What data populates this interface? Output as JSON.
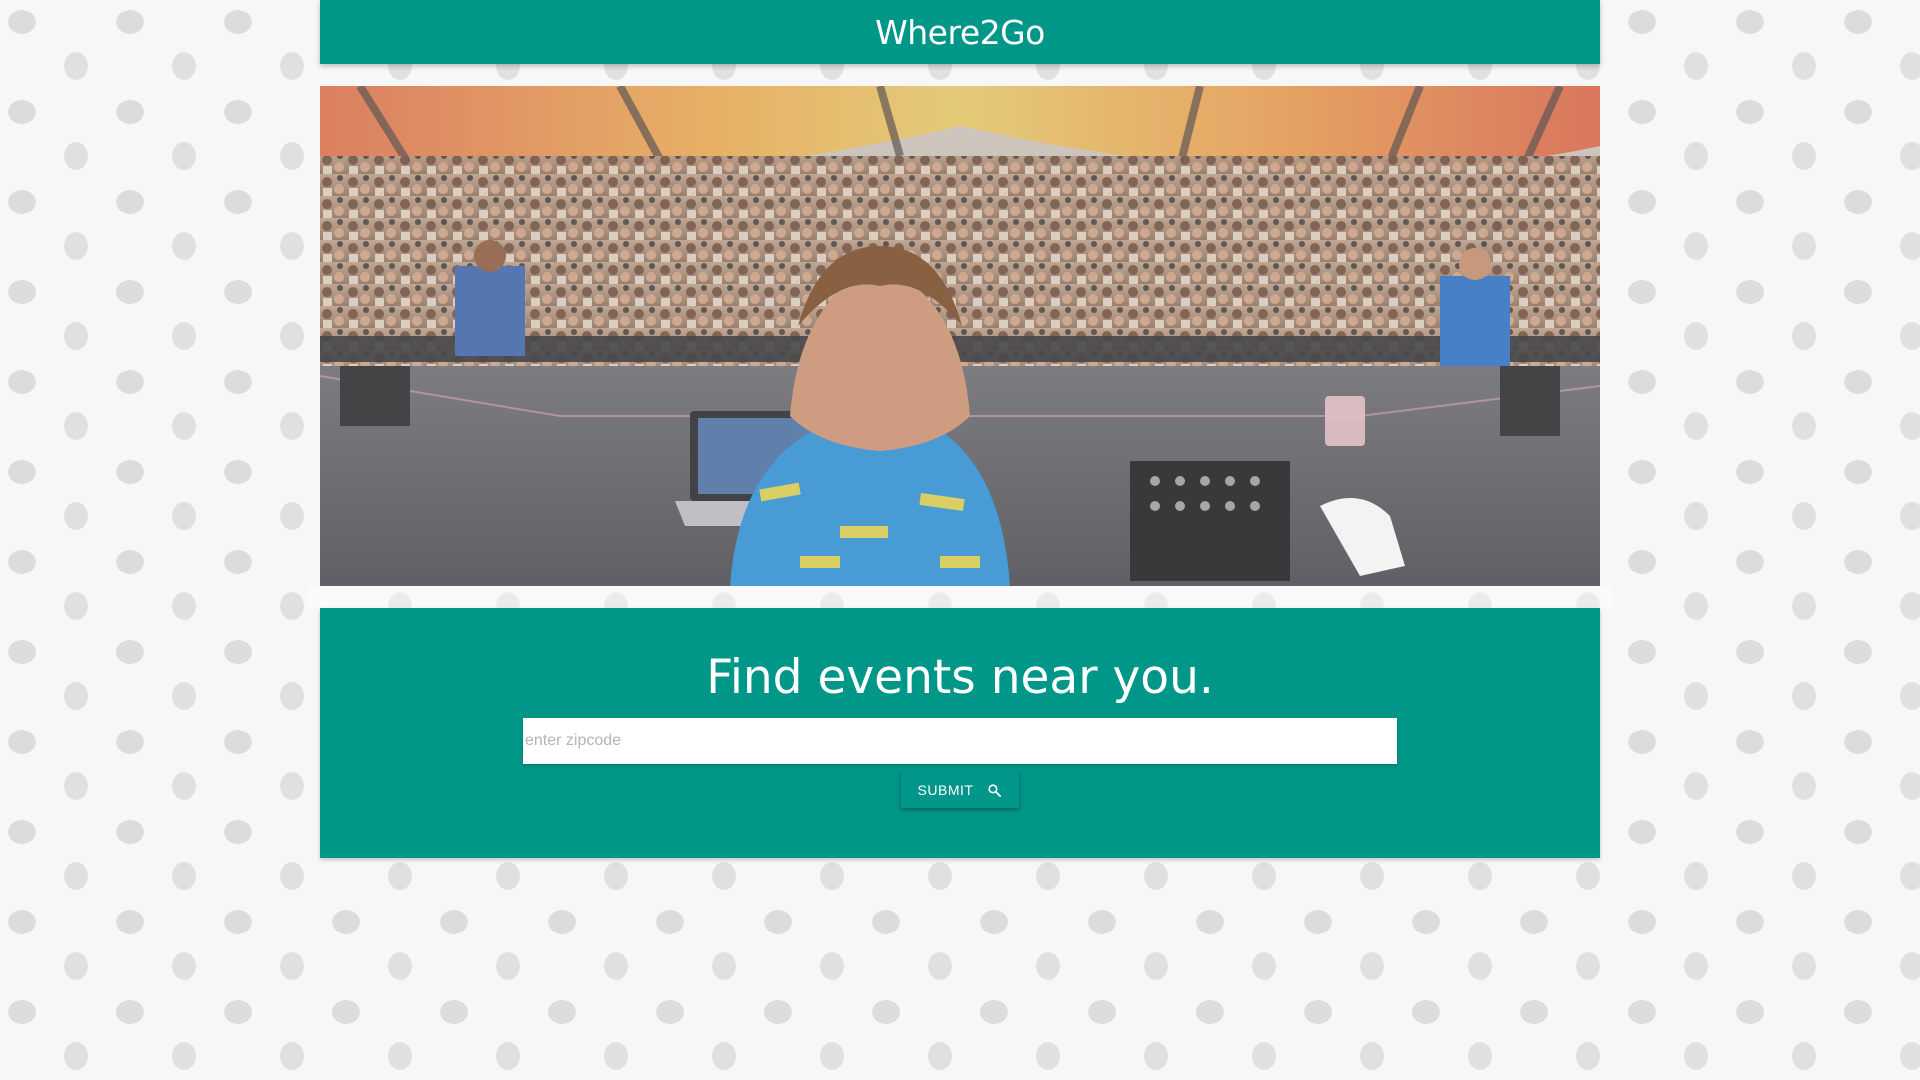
{
  "header": {
    "title": "Where2Go"
  },
  "search": {
    "heading": "Find events near you.",
    "placeholder": "enter zipcode",
    "submit_label": "SUBMIT",
    "submit_icon": "search-icon"
  },
  "colors": {
    "primary": "#009688",
    "page_background": "#f7f7f7"
  }
}
